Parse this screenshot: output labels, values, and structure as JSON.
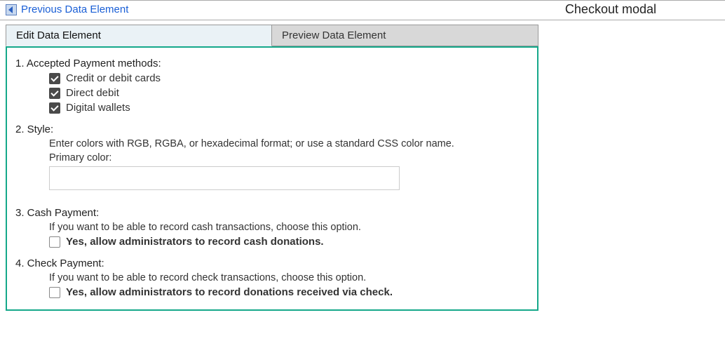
{
  "header": {
    "prev_link": "Previous Data Element",
    "title": "Checkout modal"
  },
  "tabs": {
    "edit": "Edit Data Element",
    "preview": "Preview Data Element"
  },
  "section1": {
    "title": "1. Accepted Payment methods:",
    "opt_credit": "Credit or debit cards",
    "opt_direct": "Direct debit",
    "opt_wallet": "Digital wallets"
  },
  "section2": {
    "title": "2. Style:",
    "hint": "Enter colors with RGB, RGBA, or hexadecimal format; or use a standard CSS color name.",
    "primary_label": "Primary color:",
    "primary_value": ""
  },
  "section3": {
    "title": "3. Cash Payment:",
    "hint": "If you want to be able to record cash transactions, choose this option.",
    "cb_label": "Yes, allow administrators to record cash donations."
  },
  "section4": {
    "title": "4. Check Payment:",
    "hint": "If you want to be able to record check transactions, choose this option.",
    "cb_label": "Yes, allow administrators to record donations received via check."
  }
}
